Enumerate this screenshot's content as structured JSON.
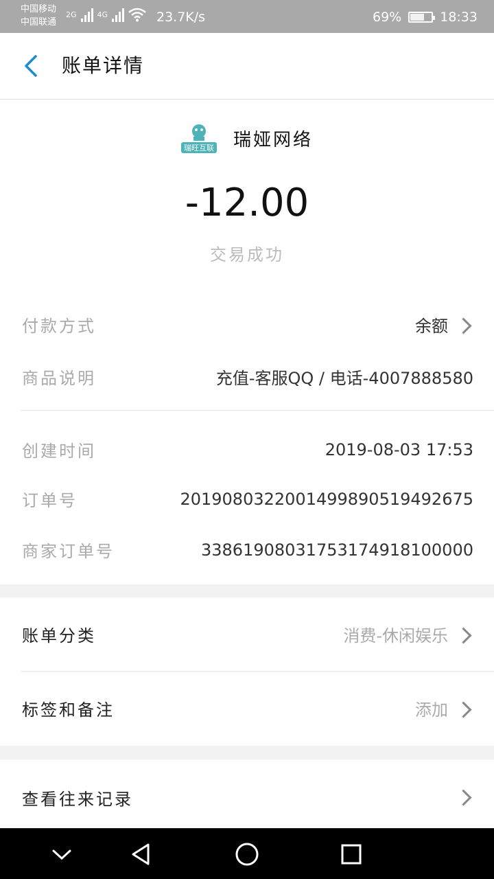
{
  "status_bar": {
    "carrier_1": "中国移动",
    "carrier_2": "中国联通",
    "net_1": "2G",
    "net_2": "4G",
    "speed": "23.7K/s",
    "battery": "69%",
    "battery_level": 0.69,
    "time": "18:33"
  },
  "header": {
    "title": "账单详情"
  },
  "merchant": {
    "logo_text": "瑞旺互联",
    "name": "瑞娅网络"
  },
  "amount": "-12.00",
  "status": "交易成功",
  "details": {
    "payment_method": {
      "label": "付款方式",
      "value": "余额"
    },
    "product_desc": {
      "label": "商品说明",
      "value": "充值-客服QQ / 电话-4007888580"
    },
    "created_time": {
      "label": "创建时间",
      "value": "2019-08-03 17:53"
    },
    "order_no": {
      "label": "订单号",
      "value": "2019080322001499890519492675"
    },
    "merchant_order_no": {
      "label": "商家订单号",
      "value": "33861908031753174918100000"
    }
  },
  "category": {
    "label": "账单分类",
    "value": "消费-休闲娱乐"
  },
  "tags": {
    "label": "标签和备注",
    "value": "添加"
  },
  "history": {
    "label": "查看往来记录"
  },
  "colors": {
    "accent": "#1a8bd6",
    "muted": "#aaaaaa"
  }
}
